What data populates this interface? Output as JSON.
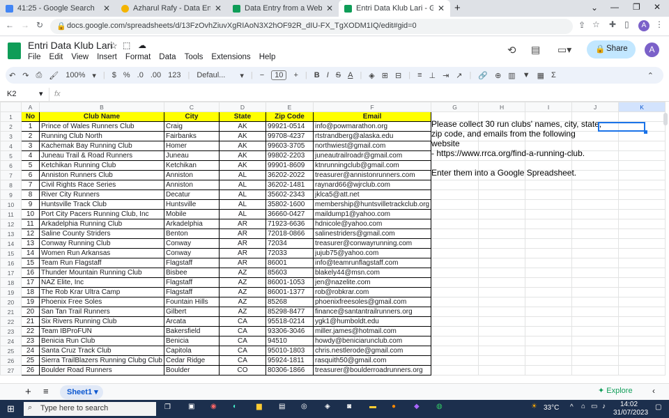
{
  "tabs": [
    {
      "title": "41:25 - Google Search",
      "color": "#4285f4"
    },
    {
      "title": "Azharul Rafy - Data Entry Project",
      "color": "#f4b400"
    },
    {
      "title": "Data Entry from a Website - Goo",
      "color": "#0f9d58"
    },
    {
      "title": "Entri Data Klub Lari - Google She",
      "color": "#0f9d58"
    }
  ],
  "url": "docs.google.com/spreadsheets/d/13FzOvhZiuvXgRIAoN3X2hOF92R_dIU-FX_TgXODM1IQ/edit#gid=0",
  "doc_title": "Entri Data Klub Lari",
  "menu": [
    "File",
    "Edit",
    "View",
    "Insert",
    "Format",
    "Data",
    "Tools",
    "Extensions",
    "Help"
  ],
  "share_label": "Share",
  "avatar_letter": "A",
  "toolbar": {
    "zoom": "100%",
    "currency": "$",
    "percent": "%",
    "dec_minus": ".0",
    "dec_plus": ".00",
    "format123": "123",
    "font": "Defaul...",
    "font_size": "10"
  },
  "cell_ref": "K2",
  "fx": "fx",
  "columns": [
    "A",
    "B",
    "C",
    "D",
    "E",
    "F",
    "G",
    "H",
    "I",
    "J",
    "K"
  ],
  "header_row": [
    "No",
    "Club Name",
    "City",
    "State",
    "Zip Code",
    "Email"
  ],
  "rows": [
    [
      "1",
      "Prince of Wales Runners Club",
      "Craig",
      "AK",
      "99921-0514",
      "info@powmarathon.org"
    ],
    [
      "2",
      "Running Club North",
      "Fairbanks",
      "AK",
      "99708-4237",
      "rtstrandberg@alaska.edu"
    ],
    [
      "3",
      "Kachemak Bay Running Club",
      "Homer",
      "AK",
      "99603-3705",
      "northwiest@gmail.com"
    ],
    [
      "4",
      "Juneau Trail & Road Runners",
      "Juneau",
      "AK",
      "99802-2203",
      "juneautrailroadr@gmail.com"
    ],
    [
      "5",
      "Ketchikan Running Club",
      "Ketchikan",
      "AK",
      "99901-8609",
      "ktnrunningclub@gmail.com"
    ],
    [
      "6",
      "Anniston Runners Club",
      "Anniston",
      "AL",
      "36202-2022",
      "treasurer@annistonrunners.com"
    ],
    [
      "7",
      "Civil Rights Race Series",
      "Anniston",
      "AL",
      "36202-1481",
      "raynard66@wjrclub.com"
    ],
    [
      "8",
      "River City Runners",
      "Decatur",
      "AL",
      "35602-2343",
      "jklca5@att.net"
    ],
    [
      "9",
      "Huntsville Track Club",
      "Huntsville",
      "AL",
      "35802-1600",
      "membership@huntsvilletrackclub.org"
    ],
    [
      "10",
      "Port City Pacers Running Club, Inc",
      "Mobile",
      "AL",
      "36660-0427",
      "maildump1@yahoo.com"
    ],
    [
      "11",
      "Arkadelphia Running Club",
      "Arkadelphia",
      "AR",
      "71923-6636",
      "hdnicole@yahoo.com"
    ],
    [
      "12",
      "Saline County Striders",
      "Benton",
      "AR",
      "72018-0866",
      "salinestriders@gmail.com"
    ],
    [
      "13",
      "Conway Running Club",
      "Conway",
      "AR",
      "72034",
      "treasurer@conwayrunning.com"
    ],
    [
      "14",
      "Women Run Arkansas",
      "Conway",
      "AR",
      "72033",
      "jujub75@yahoo.com"
    ],
    [
      "15",
      "Team Run Flagstaff",
      "Flagstaff",
      "AR",
      "86001",
      "info@teamrunflagstaff.com"
    ],
    [
      "16",
      "Thunder Mountain Running Club",
      "Bisbee",
      "AZ",
      "85603",
      "blakely44@msn.com"
    ],
    [
      "17",
      "NAZ Elite, Inc",
      "Flagstaff",
      "AZ",
      "86001-1053",
      "jen@nazelite.com"
    ],
    [
      "18",
      "The Rob Krar Ultra Camp",
      "Flagstaff",
      "AZ",
      "86001-1377",
      "rob@robkrar.com"
    ],
    [
      "19",
      "Phoenix Free Soles",
      "Fountain Hills",
      "AZ",
      "85268",
      "phoenixfreesoles@gmail.com"
    ],
    [
      "20",
      "San Tan Trail Runners",
      "Gilbert",
      "AZ",
      "85298-8477",
      "finance@santantrailrunners.org"
    ],
    [
      "21",
      "Six Rivers Running Club",
      "Arcata",
      "CA",
      "95518-0214",
      "ygk1@humboldt.edu"
    ],
    [
      "22",
      "Team IBProFUN",
      "Bakersfield",
      "CA",
      "93306-3046",
      "miller.james@hotmail.com"
    ],
    [
      "23",
      "Benicia Run Club",
      "Benicia",
      "CA",
      "94510",
      "howdy@beniciarunclub.com"
    ],
    [
      "24",
      "Santa Cruz Track Club",
      "Capitola",
      "CA",
      "95010-1803",
      "chris.nestlerode@gmail.com"
    ],
    [
      "25",
      "Sierra TrailBlazers Running Clubg Club",
      "Cedar Ridge",
      "CA",
      "95924-1811",
      "rasquith50@gmail.com"
    ],
    [
      "26",
      "Boulder Road Runners",
      "Boulder",
      "CO",
      "80306-1866",
      "treasurer@boulderroadrunners.org"
    ]
  ],
  "note_lines": [
    "Please collect 30 run clubs' names, city, state,",
    "zip code, and emails from the following website",
    "- https://www.rrca.org/find-a-running-club.",
    "",
    "Enter them into a Google Spreadsheet."
  ],
  "sheet_tab": "Sheet1",
  "explore_label": "Explore",
  "taskbar": {
    "search_placeholder": "Type here to search",
    "temperature": "33°C",
    "time": "14:02",
    "date": "31/07/2023"
  }
}
